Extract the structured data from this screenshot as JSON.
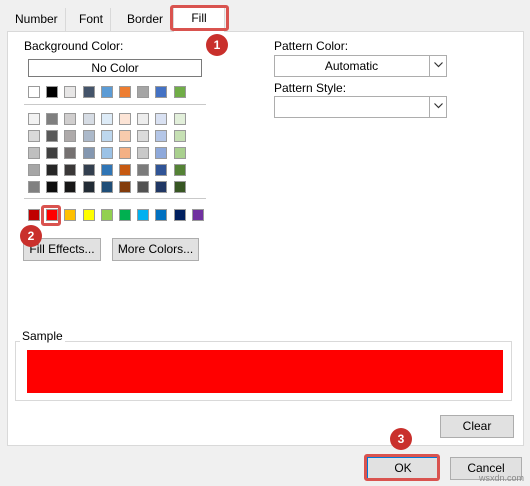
{
  "tabs": [
    "Number",
    "Font",
    "Border",
    "Fill"
  ],
  "background_color_label": "Background Color:",
  "no_color_label": "No Color",
  "palette": {
    "top_row": [
      "#ffffff",
      "#000000",
      "#e7e6e6",
      "#44546a",
      "#5b9bd5",
      "#ed7d31",
      "#a5a5a5",
      "#4472c4",
      "#70ad47"
    ],
    "theme_rows": [
      [
        "#f2f2f2",
        "#7f7f7f",
        "#d0cece",
        "#d6dce4",
        "#ddebf7",
        "#fce4d6",
        "#ededed",
        "#d9e1f2",
        "#e2efda"
      ],
      [
        "#d9d9d9",
        "#595959",
        "#aeaaaa",
        "#acb9ca",
        "#bdd7ee",
        "#f8cbad",
        "#dbdbdb",
        "#b4c6e7",
        "#c6e0b4"
      ],
      [
        "#bfbfbf",
        "#404040",
        "#757171",
        "#8497b0",
        "#9bc2e6",
        "#f4b084",
        "#c9c9c9",
        "#8ea9db",
        "#a9d08e"
      ],
      [
        "#a6a6a6",
        "#262626",
        "#3a3838",
        "#333f4f",
        "#2f75b5",
        "#c65911",
        "#7b7b7b",
        "#305496",
        "#548235"
      ],
      [
        "#808080",
        "#0d0d0d",
        "#171616",
        "#222b35",
        "#1f4e78",
        "#833c0c",
        "#525252",
        "#203764",
        "#375623"
      ]
    ],
    "standard_row": [
      "#c00000",
      "#ff0000",
      "#ffc000",
      "#ffff00",
      "#92d050",
      "#00b050",
      "#00b0f0",
      "#0070c0",
      "#002060",
      "#7030a0"
    ]
  },
  "fill_effects_label": "Fill Effects...",
  "more_colors_label": "More Colors...",
  "pattern_color_label": "Pattern Color:",
  "pattern_color_value": "Automatic",
  "pattern_style_label": "Pattern Style:",
  "pattern_style_value": "",
  "sample_label": "Sample",
  "sample_color": "#ff0000",
  "clear_label": "Clear",
  "ok_label": "OK",
  "cancel_label": "Cancel",
  "markers": [
    "1",
    "2",
    "3"
  ],
  "watermark": "wsxdn.com"
}
